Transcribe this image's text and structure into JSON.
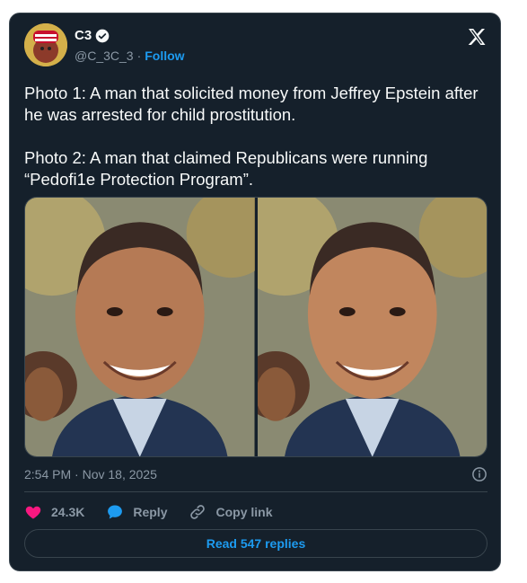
{
  "user": {
    "display_name": "C3",
    "handle": "@C_3C_3",
    "separator": "·",
    "follow_label": "Follow"
  },
  "tweet": {
    "text": "Photo 1: A man that solicited money from Jeffrey Epstein after he was arrested for child prostitution.\n\nPhoto 2: A man that claimed Republicans were running “Pedofi1e Protection Program”.",
    "timestamp": "2:54 PM · Nov 18, 2025"
  },
  "actions": {
    "like_count": "24.3K",
    "reply_label": "Reply",
    "copy_label": "Copy link"
  },
  "read_replies_label": "Read 547 replies",
  "icons": [
    "verified-icon",
    "x-logo-icon",
    "info-icon",
    "heart-icon",
    "reply-bubble-icon",
    "link-icon"
  ],
  "colors": {
    "background": "#15202b",
    "accent": "#1d9bf0",
    "like": "#f91880",
    "muted": "#8b98a5"
  }
}
